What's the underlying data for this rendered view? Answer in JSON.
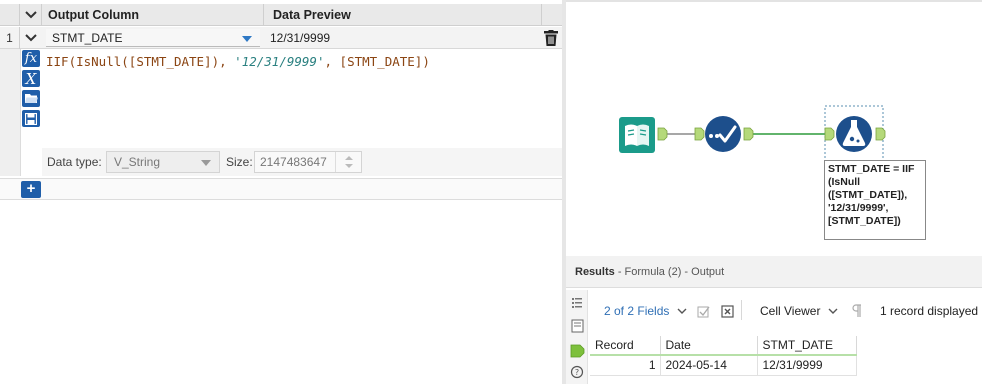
{
  "config": {
    "header": {
      "output_column": "Output Column",
      "data_preview": "Data Preview"
    },
    "row": {
      "number": "1",
      "field": "STMT_DATE",
      "preview": "12/31/9999",
      "expression": {
        "fn": "IIF(IsNull(",
        "field1": "[STMT_DATE]",
        "sep1": "), ",
        "literal": "'12/31/9999'",
        "sep2": ", ",
        "field2": "[STMT_DATE]",
        "close": ")"
      }
    },
    "tool_icons": [
      "fx-icon",
      "variable-x-icon",
      "open-folder-icon",
      "save-icon"
    ],
    "tool_glyphs": {
      "fx": "fx",
      "x": "X"
    },
    "data_type_label": "Data type:",
    "data_type_value": "V_String",
    "size_label": "Size:",
    "size_value": "2147483647",
    "add_label": "+"
  },
  "canvas": {
    "tools": [
      "input-data-icon",
      "select-icon",
      "formula-icon"
    ],
    "annotation": [
      "STMT_DATE = IIF",
      "(IsNull",
      "([STMT_DATE]),",
      "'12/31/9999',",
      "[STMT_DATE])"
    ],
    "colors": {
      "input": "#1b9b8a",
      "select": "#1d4f8c",
      "formula": "#1d4f8c",
      "connector": "#2e9c3c",
      "anchor": "#b5d97a"
    }
  },
  "results": {
    "title": "Results",
    "subtitle": "- Formula (2) - Output",
    "fields_selector": "2 of 2 Fields",
    "cell_viewer": "Cell Viewer",
    "record_count": "1 record displayed",
    "columns": [
      "Record",
      "Date",
      "STMT_DATE"
    ],
    "rows": [
      {
        "record": "1",
        "date": "2024-05-14",
        "stmt_date": "12/31/9999"
      }
    ]
  }
}
